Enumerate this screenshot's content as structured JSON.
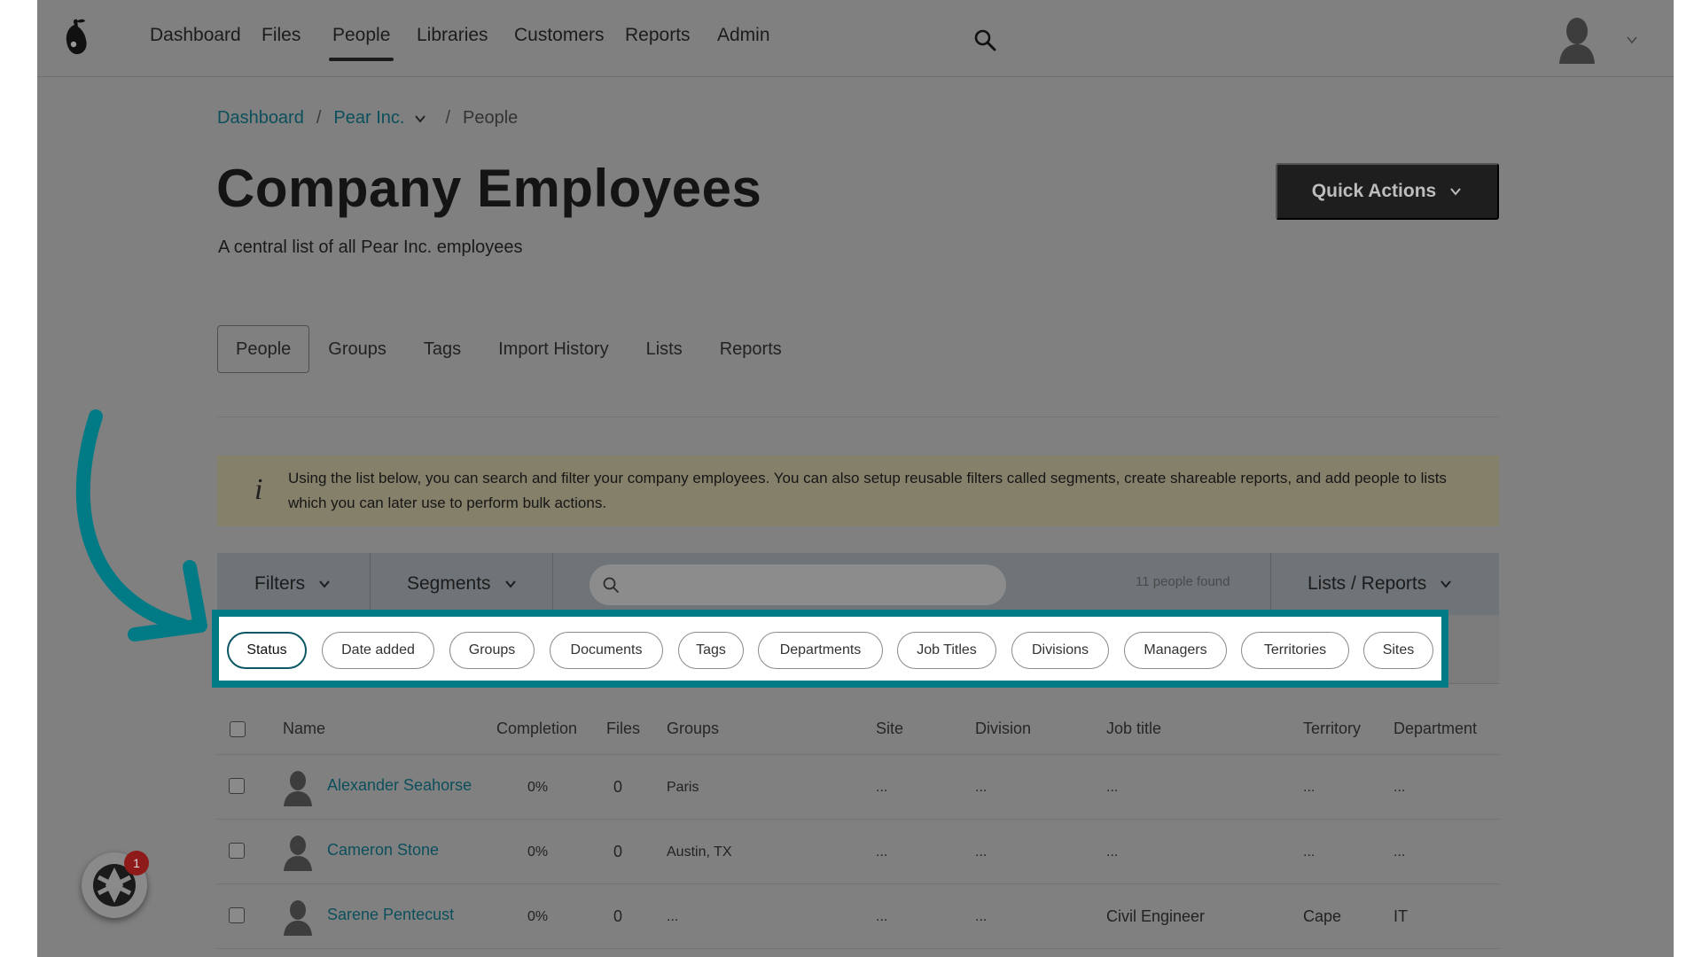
{
  "nav": {
    "items": [
      {
        "label": "Dashboard"
      },
      {
        "label": "Files"
      },
      {
        "label": "People"
      },
      {
        "label": "Libraries"
      },
      {
        "label": "Customers"
      },
      {
        "label": "Reports"
      },
      {
        "label": "Admin"
      }
    ],
    "active": "People"
  },
  "breadcrumb": {
    "home": "Dashboard",
    "sep1": "/",
    "company": "Pear Inc.",
    "sep2": "/",
    "current": "People"
  },
  "page": {
    "title": "Company Employees",
    "subtitle": "A central list of all Pear Inc. employees",
    "quick_actions": "Quick Actions"
  },
  "tabs": [
    "People",
    "Groups",
    "Tags",
    "Import History",
    "Lists",
    "Reports"
  ],
  "info": {
    "icon": "i",
    "text": "Using the list below, you can search and filter your company employees. You can also setup reusable filters called segments, create shareable reports, and add people to lists which you can later use to perform bulk actions."
  },
  "toolbar": {
    "filters": "Filters",
    "segments": "Segments",
    "search_placeholder": "",
    "count": "11 people found",
    "lists_reports": "Lists / Reports"
  },
  "chips": [
    "Status",
    "Date added",
    "Groups",
    "Documents",
    "Tags",
    "Departments",
    "Job Titles",
    "Divisions",
    "Managers",
    "Territories",
    "Sites"
  ],
  "table": {
    "headers": {
      "name": "Name",
      "completion": "Completion",
      "files": "Files",
      "groups": "Groups",
      "site": "Site",
      "division": "Division",
      "job_title": "Job title",
      "territory": "Territory",
      "department": "Department"
    },
    "rows": [
      {
        "name": "Alexander Seahorse",
        "completion": "0%",
        "files": "0",
        "groups": "Paris",
        "site": "...",
        "division": "...",
        "job_title": "...",
        "territory": "...",
        "department": "..."
      },
      {
        "name": "Cameron Stone",
        "completion": "0%",
        "files": "0",
        "groups": "Austin, TX",
        "site": "...",
        "division": "...",
        "job_title": "...",
        "territory": "...",
        "department": "..."
      },
      {
        "name": "Sarene Pentecust",
        "completion": "0%",
        "files": "0",
        "groups": "...",
        "site": "...",
        "division": "...",
        "job_title": "Civil Engineer",
        "territory": "Cape",
        "department": "IT"
      }
    ]
  },
  "help_widget": {
    "badge": "1",
    "icon": "chat-logo-icon"
  },
  "colors": {
    "highlight": "#007b86",
    "link": "#0c4f5c",
    "dark_button": "#1e1e1e",
    "banner": "#85806a"
  }
}
